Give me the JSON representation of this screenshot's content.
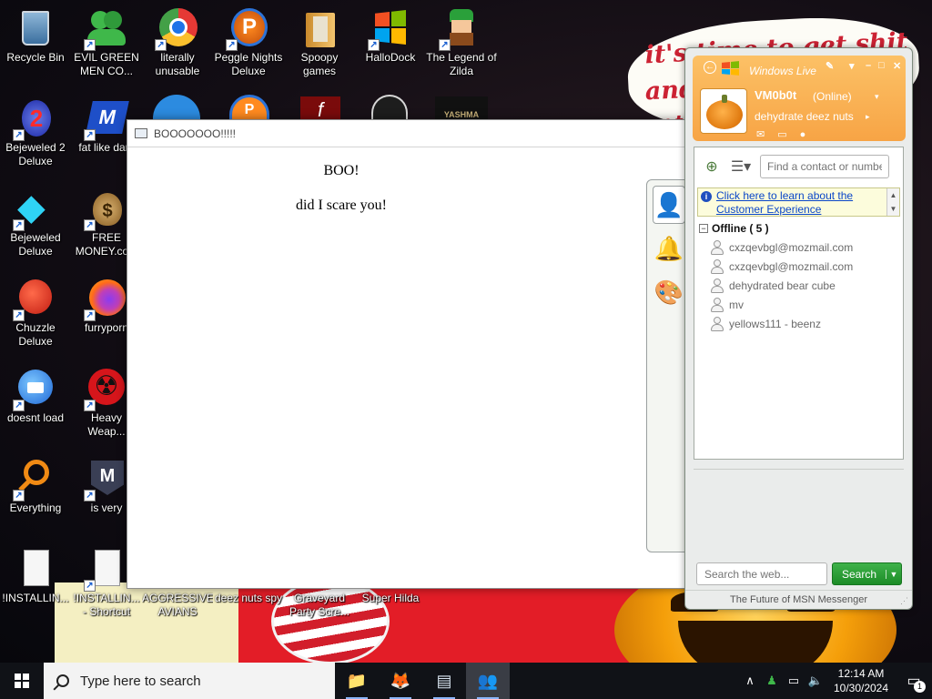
{
  "desktop": {
    "icons": [
      {
        "label": "Recycle Bin",
        "glyph": "🗑",
        "icon": "recycle-bin-icon"
      },
      {
        "label": "EVIL GREEN MEN CO...",
        "glyph": "👥",
        "icon": "green-men-icon"
      },
      {
        "label": "literally unusable",
        "glyph": "◉",
        "icon": "chrome-icon"
      },
      {
        "label": "Peggle Nights Deluxe",
        "glyph": "P",
        "icon": "peggle-icon"
      },
      {
        "label": "Spoopy games",
        "glyph": "📁",
        "icon": "folder-icon"
      },
      {
        "label": "HalloDock",
        "glyph": "⊞",
        "icon": "windows-logo-icon"
      },
      {
        "label": "The Legend of Zilda",
        "glyph": "🧝",
        "icon": "zelda-icon"
      },
      {
        "label": "Bejeweled 2 Deluxe",
        "glyph": "2",
        "icon": "bejeweled2-icon"
      },
      {
        "label": "fat like dark",
        "glyph": "M",
        "icon": "mpl-icon"
      },
      {
        "label": "Bejeweled Deluxe",
        "glyph": "◆",
        "icon": "gem-icon"
      },
      {
        "label": "FREE MONEY.com",
        "glyph": "💰",
        "icon": "money-bag-icon"
      },
      {
        "label": "Chuzzle Deluxe",
        "glyph": "●",
        "icon": "chuzzle-icon"
      },
      {
        "label": "furryporn",
        "glyph": "🦊",
        "icon": "firefox-icon"
      },
      {
        "label": "doesnt load",
        "glyph": "🐦",
        "icon": "thunderbird-icon"
      },
      {
        "label": "Heavy Weap...",
        "glyph": "☢",
        "icon": "radiation-icon"
      },
      {
        "label": "Everything",
        "glyph": "○",
        "icon": "everything-search-icon"
      },
      {
        "label": "is very",
        "glyph": "M",
        "icon": "mpl-icon-2"
      },
      {
        "label": "!INSTALLIN...",
        "glyph": "📄",
        "icon": "document-icon"
      },
      {
        "label": "!INSTALLIN... - Shortcut",
        "glyph": "📄",
        "icon": "document-shortcut-icon"
      },
      {
        "label": "AGGRESSIVE AVIANS",
        "glyph": "",
        "icon": "aggressive-avians-icon"
      },
      {
        "label": "deez nuts spy",
        "glyph": "",
        "icon": "spy-icon"
      },
      {
        "label": "Graveyard Party Scre...",
        "glyph": "",
        "icon": "graveyard-icon"
      },
      {
        "label": "Super Hilda",
        "glyph": "",
        "icon": "super-hilda-icon"
      }
    ],
    "partial_icons": [
      "◐",
      "P",
      "f",
      "▣",
      "YASHMA"
    ]
  },
  "wallpaper_text": [
    "it's time to get shit",
    "and",
    "or t"
  ],
  "boo_window": {
    "title": "BOOOOOOO!!!!!",
    "heading": "BOO!",
    "line": "did I scare you!"
  },
  "side_dock": {
    "icons": [
      "👤",
      "🔔",
      "🎨"
    ]
  },
  "messenger": {
    "title": "Windows Live",
    "user_name": "VM0b0t",
    "status": "(Online)",
    "personal_message": "dehydrate deez nuts",
    "find_placeholder": "Find a contact or number...",
    "banner_link": "Click here to learn about the Customer Experience",
    "group_label": "Offline ( 5 )",
    "contacts": [
      "cxzqevbgl@mozmail.com",
      "cxzqevbgl@mozmail.com",
      "dehydrated bear cube",
      "mv",
      "yellows111 - beenz"
    ],
    "web_search_placeholder": "Search the web...",
    "search_label": "Search",
    "footer": "The Future of MSN Messenger",
    "accent_color": "#f7a445",
    "search_button_color": "#1c8c27"
  },
  "taskbar": {
    "search_placeholder": "Type here to search",
    "apps": [
      "📁",
      "🦊",
      "▤",
      "👥"
    ],
    "time": "12:14 AM",
    "date": "10/30/2024",
    "notification_count": "1"
  }
}
